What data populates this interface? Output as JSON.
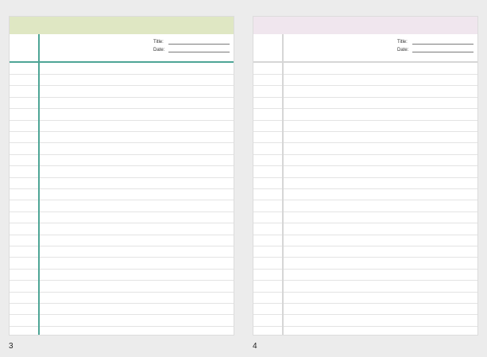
{
  "pages": [
    {
      "number": "3",
      "header_color": "#dfe7c3",
      "margin_color": "#4ea596",
      "rule_color": "#4ea596",
      "fields": {
        "title_label": "Title:",
        "date_label": "Date:"
      }
    },
    {
      "number": "4",
      "header_color": "#f0e6ee",
      "margin_color": "#d6d6d6",
      "rule_color": "#d6d6d6",
      "fields": {
        "title_label": "Title:",
        "date_label": "Date:"
      }
    }
  ]
}
